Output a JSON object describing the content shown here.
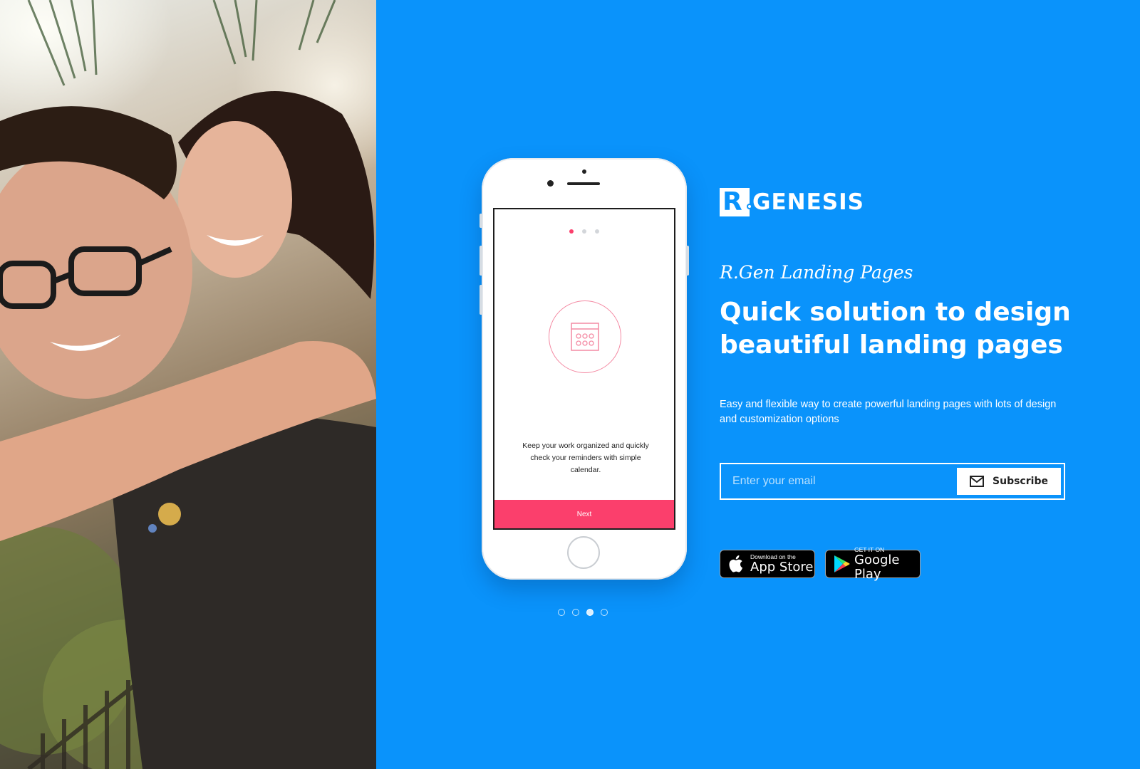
{
  "brand": {
    "logo_mark": "R",
    "logo_text": "GENESIS"
  },
  "hero": {
    "tagline": "R.Gen Landing Pages",
    "headline": "Quick solution to design beautiful landing pages",
    "subtext": "Easy and flexible way to create powerful landing pages with lots of design and customization options"
  },
  "subscribe": {
    "placeholder": "Enter your email",
    "button_label": "Subscribe",
    "button_icon": "envelope-icon"
  },
  "badges": {
    "apple": {
      "small": "Download on the",
      "big": "App Store",
      "icon": "apple-icon"
    },
    "google": {
      "small": "GET IT ON",
      "big": "Google Play",
      "icon": "google-play-icon"
    }
  },
  "phone_screen": {
    "page_indicator": {
      "count": 3,
      "active": 0
    },
    "icon": "calendar-icon",
    "text": "Keep your work organized and quickly check your reminders with simple calendar.",
    "next_label": "Next"
  },
  "carousel": {
    "count": 4,
    "active": 2
  },
  "colors": {
    "background": "#0a93fb",
    "accent": "#fb3f6c",
    "white": "#ffffff"
  },
  "photo": {
    "alt": "couple-photo"
  }
}
